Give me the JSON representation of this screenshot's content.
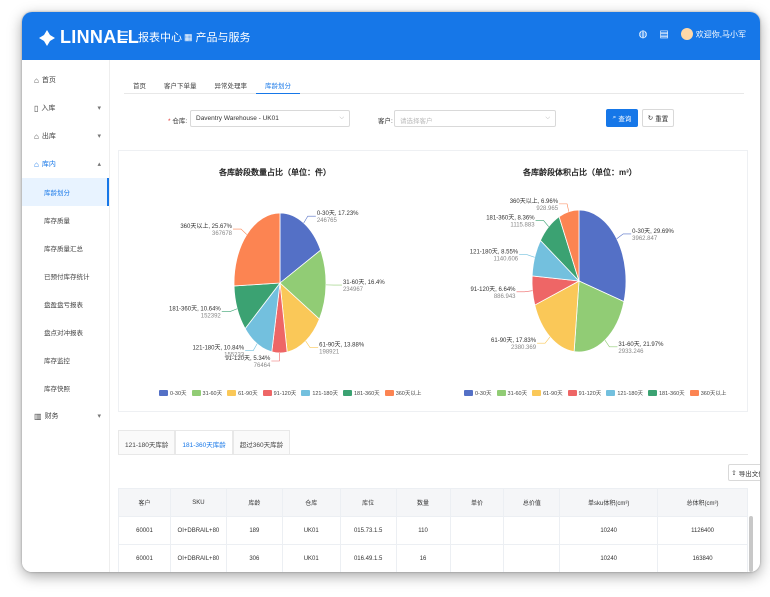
{
  "brand": {
    "name": "LINNALL"
  },
  "header": {
    "menu_icon": "menu-fold-icon",
    "nav": [
      "报表中心",
      "产品与服务"
    ],
    "user": "欢迎你,马小军"
  },
  "sidebar": {
    "items": [
      {
        "label": "首页",
        "icon": "home-icon"
      },
      {
        "label": "入库",
        "icon": "inbound-icon"
      },
      {
        "label": "出库",
        "icon": "outbound-icon"
      },
      {
        "label": "库内",
        "icon": "warehouse-icon"
      }
    ],
    "subitems": [
      "库龄划分",
      "库存质量",
      "库存质量汇总",
      "已预付库存统计",
      "盘盈盘亏报表",
      "盘点对冲报表",
      "库存监控",
      "库存快照"
    ],
    "finance": {
      "label": "财务",
      "icon": "finance-icon"
    }
  },
  "tabs": [
    "首页",
    "客户下单量",
    "异常处理率",
    "库龄划分"
  ],
  "filter": {
    "warehouse_label": "仓库:",
    "warehouse_value": "Daventry Warehouse - UK01",
    "customer_label": "客户:",
    "customer_placeholder": "请选择客户",
    "query_label": "查询",
    "reset_label": "重置"
  },
  "chart_data": [
    {
      "type": "pie",
      "title": "各库龄段数量占比（单位：件）",
      "labels": [
        "0-30天",
        "31-60天",
        "61-90天",
        "91-120天",
        "121-180天",
        "181-360天",
        "360天以上"
      ],
      "values": [
        246765,
        234967,
        198921,
        76464,
        155233,
        152392,
        367678
      ],
      "percents": [
        "17.23%",
        "16.4%",
        "13.88%",
        "5.34%",
        "10.84%",
        "10.64%",
        "25.67%"
      ],
      "value_labels": [
        "246765",
        "234967",
        "198921",
        "76464",
        "155233",
        "152392",
        "367678"
      ],
      "colors": [
        "#5470c6",
        "#91cc75",
        "#fac858",
        "#ee6666",
        "#73c0de",
        "#3ba272",
        "#fc8452"
      ]
    },
    {
      "type": "pie",
      "title": "各库龄段体积占比（单位：m³）",
      "labels": [
        "0-30天",
        "31-60天",
        "61-90天",
        "91-120天",
        "121-180天",
        "181-360天",
        "360天以上"
      ],
      "values": [
        3962.847,
        2933.246,
        2380.369,
        886.943,
        1140.606,
        1115.883,
        928.965
      ],
      "percents": [
        "29.69%",
        "21.97%",
        "17.83%",
        "6.64%",
        "8.55%",
        "8.36%",
        "6.96%"
      ],
      "value_labels": [
        "3962.847",
        "2933.246",
        "2380.369",
        "886.943",
        "1140.606",
        "1115.883",
        "928.965"
      ],
      "colors": [
        "#5470c6",
        "#91cc75",
        "#fac858",
        "#ee6666",
        "#73c0de",
        "#3ba272",
        "#fc8452"
      ]
    }
  ],
  "subtabs": [
    "121-180天库龄",
    "181-360天库龄",
    "超过360天库龄"
  ],
  "export_label": "导出文件",
  "table": {
    "headers": [
      "客户",
      "SKU",
      "库龄",
      "仓库",
      "库位",
      "数量",
      "单价",
      "总价值",
      "单sku体积(cm³)",
      "总体积(cm³)"
    ],
    "rows": [
      [
        "60001",
        "OI+DBRAIL+80",
        "189",
        "UK01",
        "015.73.1.5",
        "110",
        "",
        "",
        "10240",
        "1126400"
      ],
      [
        "60001",
        "OI+DBRAIL+80",
        "306",
        "UK01",
        "016.49.1.5",
        "16",
        "",
        "",
        "10240",
        "163840"
      ]
    ]
  }
}
